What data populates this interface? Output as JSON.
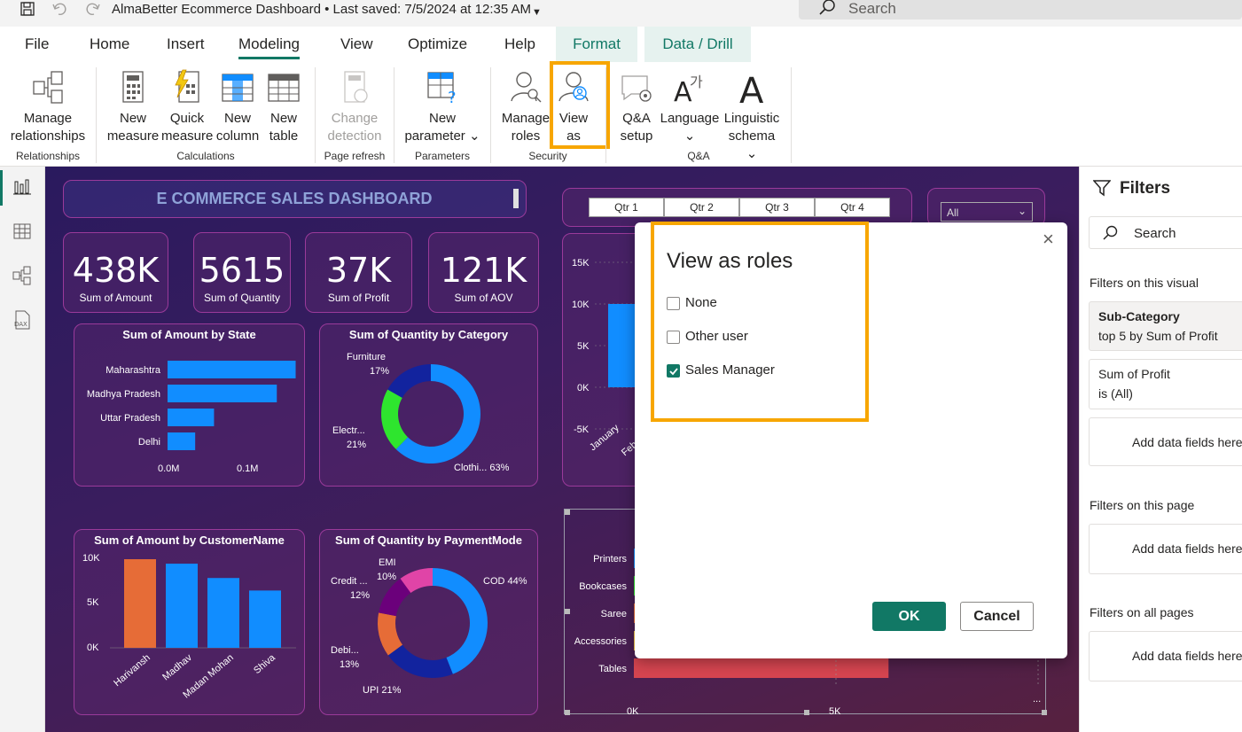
{
  "titlebar": {
    "title": "AlmaBetter Ecommerce Dashboard • Last saved: 7/5/2024 at 12:35 AM",
    "search": "Search"
  },
  "tabs": [
    {
      "label": "File"
    },
    {
      "label": "Home"
    },
    {
      "label": "Insert"
    },
    {
      "label": "Modeling"
    },
    {
      "label": "View"
    },
    {
      "label": "Optimize"
    },
    {
      "label": "Help"
    },
    {
      "label": "Format"
    },
    {
      "label": "Data / Drill"
    }
  ],
  "ribbon": {
    "manage_rel": {
      "l1": "Manage",
      "l2": "relationships"
    },
    "new_measure": {
      "l1": "New",
      "l2": "measure"
    },
    "quick_measure": {
      "l1": "Quick",
      "l2": "measure"
    },
    "new_column": {
      "l1": "New",
      "l2": "column"
    },
    "new_table": {
      "l1": "New",
      "l2": "table"
    },
    "change_detection": {
      "l1": "Change",
      "l2": "detection"
    },
    "new_parameter": {
      "l1": "New",
      "l2": "parameter"
    },
    "manage_roles": {
      "l1": "Manage",
      "l2": "roles"
    },
    "view_as": {
      "l1": "View",
      "l2": "as"
    },
    "qa_setup": {
      "l1": "Q&A",
      "l2": "setup"
    },
    "language": {
      "l1": "Language"
    },
    "linguistic": {
      "l1": "Linguistic",
      "l2": "schema"
    },
    "groups": {
      "relationships": "Relationships",
      "calculations": "Calculations",
      "page_refresh": "Page refresh",
      "parameters": "Parameters",
      "security": "Security",
      "qa": "Q&A"
    }
  },
  "dashboard": {
    "title": "E COMMERCE SALES DASHBOARD",
    "kpis": [
      {
        "value": "438K",
        "label": "Sum of Amount"
      },
      {
        "value": "5615",
        "label": "Sum of Quantity"
      },
      {
        "value": "37K",
        "label": "Sum of Profit"
      },
      {
        "value": "121K",
        "label": "Sum of AOV"
      }
    ],
    "quarters": [
      "Qtr 1",
      "Qtr 2",
      "Qtr 3",
      "Qtr 4"
    ],
    "slicer_value": "All",
    "state_chart": {
      "title": "Sum of Amount by State",
      "ticks": [
        "0.0M",
        "0.1M"
      ]
    },
    "category_chart": {
      "title": "Sum of Quantity by Category",
      "labels": {
        "furniture": "Furniture",
        "furniture_pct": "17%",
        "electronics": "Electr...",
        "electronics_pct": "21%",
        "clothing": "Clothi... 63%"
      }
    },
    "customer_chart": {
      "title": "Sum of Amount by CustomerName",
      "yticks": [
        "10K",
        "5K",
        "0K"
      ]
    },
    "payment_chart": {
      "title": "Sum of Quantity by PaymentMode",
      "labels": {
        "emi": "EMI",
        "emi_pct": "10%",
        "credit": "Credit ...",
        "credit_pct": "12%",
        "cod": "COD 44%",
        "debit": "Debi...",
        "debit_pct": "13%",
        "upi": "UPI 21%"
      }
    },
    "monthly_chart": {
      "yticks": [
        "15K",
        "10K",
        "5K",
        "0K",
        "-5K"
      ],
      "xlabels": [
        "January",
        "Feb"
      ]
    },
    "subcat_chart": {
      "xticks": [
        "0K",
        "5K"
      ],
      "more": "..."
    }
  },
  "chart_data": [
    {
      "type": "bar",
      "title": "Sum of Amount by State",
      "categories": [
        "Maharashtra",
        "Madhya Pradesh",
        "Uttar Pradesh",
        "Delhi"
      ],
      "values": [
        0.102,
        0.087,
        0.037,
        0.022
      ],
      "xlim": [
        0,
        0.12
      ]
    },
    {
      "type": "pie",
      "title": "Sum of Quantity by Category",
      "categories": [
        "Clothing",
        "Electronics",
        "Furniture"
      ],
      "values": [
        63,
        21,
        17
      ],
      "colors": [
        "#118dff",
        "#2ee52e",
        "#12239e"
      ]
    },
    {
      "type": "bar",
      "title": "Sum of Amount by CustomerName",
      "categories": [
        "Harivansh",
        "Madhav",
        "Madan Mohan",
        "Shiva"
      ],
      "values": [
        9.9,
        9.4,
        7.8,
        6.4
      ],
      "ylim": [
        0,
        10
      ],
      "colors": [
        "#e66c37",
        "#118dff",
        "#118dff",
        "#118dff"
      ]
    },
    {
      "type": "pie",
      "title": "Sum of Quantity by PaymentMode",
      "categories": [
        "COD",
        "UPI",
        "Debit Card",
        "Credit Card",
        "EMI"
      ],
      "values": [
        44,
        21,
        13,
        12,
        10
      ],
      "colors": [
        "#118dff",
        "#12239e",
        "#e66c37",
        "#6b007b",
        "#e044a7"
      ]
    },
    {
      "type": "bar",
      "categories": [
        "Printers",
        "Bookcases",
        "Saree",
        "Accessories",
        "Tables"
      ],
      "values": [
        0.05,
        0.05,
        0.05,
        0.05,
        6.3
      ],
      "xlim": [
        0,
        20
      ],
      "colors": [
        "#118dff",
        "#2ee52e",
        "#e66c37",
        "#f5c54a",
        "#d64550"
      ]
    },
    {
      "type": "bar",
      "categories": [
        "January",
        "Feb"
      ],
      "values": [
        10.0,
        0
      ],
      "ylim": [
        -5,
        15
      ]
    }
  ],
  "filters": {
    "title": "Filters",
    "search": "Search",
    "on_visual": "Filters on this visual",
    "card1_title": "Sub-Category",
    "card1_sub": "top 5 by Sum of Profit",
    "card2_title": "Sum of Profit",
    "card2_sub": "is (All)",
    "add_fields": "Add data fields here",
    "on_page": "Filters on this page",
    "on_all": "Filters on all pages"
  },
  "dialog": {
    "title": "View as roles",
    "options": [
      {
        "label": "None",
        "checked": false
      },
      {
        "label": "Other user",
        "checked": false
      },
      {
        "label": "Sales Manager",
        "checked": true
      }
    ],
    "ok": "OK",
    "cancel": "Cancel"
  },
  "colors": {
    "accent": "#117865",
    "highlight": "#f7a600",
    "bar": "#118dff"
  }
}
